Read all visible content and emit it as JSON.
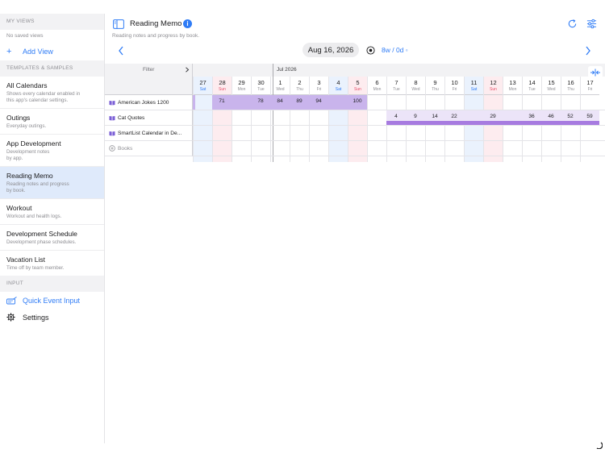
{
  "sidebar": {
    "my_views_header": "MY VIEWS",
    "no_saved_views": "No saved views",
    "add_view": "Add View",
    "templates_header": "TEMPLATES & SAMPLES",
    "items": [
      {
        "title": "All Calendars",
        "subtitle": "Shows every calendar enabled in\nthis app's calendar settings."
      },
      {
        "title": "Outings",
        "subtitle": "Everyday outings."
      },
      {
        "title": "App Development",
        "subtitle": "Development notes\nby app."
      },
      {
        "title": "Reading Memo",
        "subtitle": "Reading notes and progress\nby book."
      },
      {
        "title": "Workout",
        "subtitle": "Workout and health logs."
      },
      {
        "title": "Development Schedule",
        "subtitle": "Development phase schedules."
      },
      {
        "title": "Vacation List",
        "subtitle": "Time off by team member."
      }
    ],
    "input_header": "INPUT",
    "quick_event_input": "Quick Event Input",
    "settings": "Settings"
  },
  "header": {
    "title": "Reading Memo",
    "subtitle": "Reading notes and progress by book.",
    "date": "Aug 16, 2026",
    "range": "8w / 0d ◦"
  },
  "grid": {
    "filter": "Filter",
    "month_label": "Jul 2026",
    "days": [
      {
        "n": "27",
        "w": "Sat",
        "k": "sat"
      },
      {
        "n": "28",
        "w": "Sun",
        "k": "sun"
      },
      {
        "n": "29",
        "w": "Mon",
        "k": ""
      },
      {
        "n": "30",
        "w": "Tue",
        "k": ""
      },
      {
        "n": "1",
        "w": "Wed",
        "k": ""
      },
      {
        "n": "2",
        "w": "Thu",
        "k": ""
      },
      {
        "n": "3",
        "w": "Fri",
        "k": ""
      },
      {
        "n": "4",
        "w": "Sat",
        "k": "sat"
      },
      {
        "n": "5",
        "w": "Sun",
        "k": "sun"
      },
      {
        "n": "6",
        "w": "Mon",
        "k": ""
      },
      {
        "n": "7",
        "w": "Tue",
        "k": ""
      },
      {
        "n": "8",
        "w": "Wed",
        "k": ""
      },
      {
        "n": "9",
        "w": "Thu",
        "k": ""
      },
      {
        "n": "10",
        "w": "Fri",
        "k": ""
      },
      {
        "n": "11",
        "w": "Sat",
        "k": "sat"
      },
      {
        "n": "12",
        "w": "Sun",
        "k": "sun"
      },
      {
        "n": "13",
        "w": "Mon",
        "k": ""
      },
      {
        "n": "14",
        "w": "Tue",
        "k": ""
      },
      {
        "n": "15",
        "w": "Wed",
        "k": ""
      },
      {
        "n": "16",
        "w": "Thu",
        "k": ""
      },
      {
        "n": "17",
        "w": "Fri",
        "k": ""
      }
    ],
    "rows": [
      {
        "name": "American Jokes 1200",
        "entries": [
          {
            "day": 1,
            "value": "71"
          },
          {
            "day": 3,
            "value": "78"
          },
          {
            "day": 4,
            "value": "84"
          },
          {
            "day": 5,
            "value": "89"
          },
          {
            "day": 6,
            "value": "94"
          },
          {
            "day": 8,
            "value": "100"
          }
        ]
      },
      {
        "name": "Cat Quotes",
        "entries": [
          {
            "day": 10,
            "value": "4"
          },
          {
            "day": 11,
            "value": "9"
          },
          {
            "day": 12,
            "value": "14"
          },
          {
            "day": 13,
            "value": "22"
          },
          {
            "day": 15,
            "value": "29"
          },
          {
            "day": 17,
            "value": "36"
          },
          {
            "day": 18,
            "value": "46"
          },
          {
            "day": 19,
            "value": "52"
          },
          {
            "day": 20,
            "value": "59"
          }
        ]
      },
      {
        "name": "SmartList Calendar in De...",
        "entries": []
      }
    ],
    "add_row_label": "Books"
  },
  "colors": {
    "accent": "#2f7cf6",
    "bar": "#c9b4ec",
    "bar_light": "#ece4f8",
    "progress": "#a77be0",
    "saturday": "#eaf2fd",
    "sunday": "#fdecef"
  }
}
